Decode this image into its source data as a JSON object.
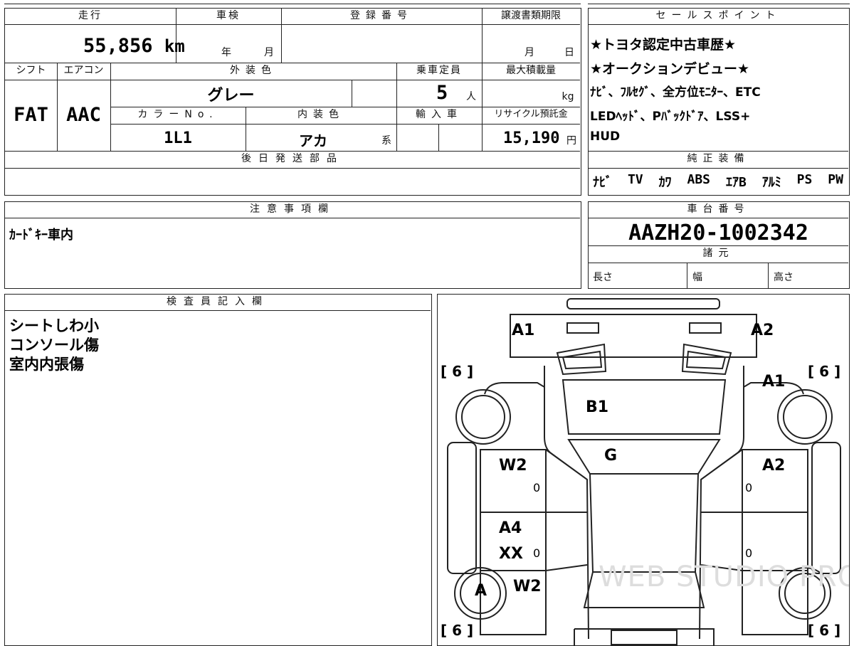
{
  "main": {
    "mileage_header": "走行",
    "mileage": "55,856",
    "mileage_unit": "km",
    "inspection_header": "車検",
    "inspection_year": "年",
    "inspection_month": "月",
    "reg_header": "登録番号",
    "transfer_header": "譲渡書類期限",
    "transfer_month": "月",
    "transfer_day": "日",
    "shift_header": "シフト",
    "shift": "FAT",
    "ac_header": "エアコン",
    "ac": "AAC",
    "exterior_header": "外装色",
    "exterior": "グレー",
    "capacity_header": "乗車定員",
    "capacity": "5",
    "capacity_unit": "人",
    "load_header": "最大積載量",
    "load_unit": "kg",
    "colorno_header": "カラーNo.",
    "colorno": "1L1",
    "interior_header": "内装色",
    "interior": "アカ",
    "interior_suffix": "系",
    "import_header": "輸入車",
    "recycle_header": "リサイクル預託金",
    "recycle": "15,190",
    "recycle_unit": "円",
    "later_parts_header": "後日発送部品"
  },
  "sales": {
    "header": "セールスポイント",
    "lines": [
      "★トヨタ認定中古車歴★",
      "★オークションデビュー★",
      "ﾅﾋﾞ、ﾌﾙｾｸﾞ、全方位ﾓﾆﾀｰ、ETC",
      "LEDﾍｯﾄﾞ、Pﾊﾞｯｸﾄﾞｱ、LSS+",
      "HUD"
    ]
  },
  "equipment": {
    "header": "純正装備",
    "items": [
      "ﾅﾋﾞ",
      "TV",
      "ｶﾜ",
      "ABS",
      "ｴｱB",
      "ｱﾙﾐ",
      "PS",
      "PW"
    ]
  },
  "notes": {
    "header": "注意事項欄",
    "text": "ｶｰﾄﾞｷｰ車内"
  },
  "chassis": {
    "header": "車台番号",
    "number": "AAZH20-1002342",
    "specs_header": "諸元",
    "length": "長さ",
    "width": "幅",
    "height": "高さ"
  },
  "inspector": {
    "header": "検査員記入欄",
    "lines": [
      "シートしわ小",
      "コンソール傷",
      "室内内張傷"
    ]
  },
  "diagram": {
    "bracket_label": "[ 6 ]",
    "marks": {
      "front_left": "A1",
      "front_right": "A2",
      "fender_right": "A1",
      "hood": "B1",
      "windshield": "G",
      "door_left_front": "W2",
      "door_right_front": "A2",
      "door_left_rear_a": "A4",
      "door_left_rear_b": "XX",
      "rear_left_wheel": "A",
      "rear_left_w": "W2",
      "zero": "0"
    },
    "watermark": "WEB STUDIO PRO"
  }
}
